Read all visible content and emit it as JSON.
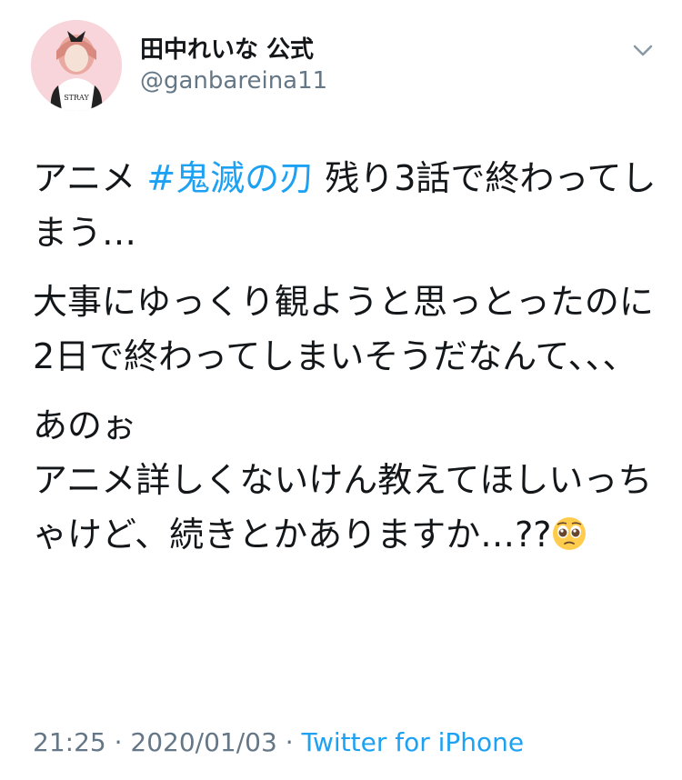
{
  "user": {
    "display_name": "田中れいな 公式",
    "handle": "@ganbareina11",
    "avatar_text": "STRAY"
  },
  "tweet": {
    "p1_pre": "アニメ ",
    "hashtag": "#鬼滅の刃",
    "p1_post": " 残り3話で終わってしまう…",
    "p2": "大事にゆっくり観ようと思っとったのに2日で終わってしまいそうだなんて、、、",
    "p3_line1": "あのぉ",
    "p3_line2": "アニメ詳しくないけん教えてほしいっちゃけど、続きとかありますか…??",
    "emoji": "pleading-face"
  },
  "meta": {
    "time": "21:25",
    "sep1": " · ",
    "date": "2020/01/03",
    "sep2": " · ",
    "source": "Twitter for iPhone"
  },
  "colors": {
    "link": "#1da1f2",
    "secondary": "#657786",
    "text": "#14171a"
  }
}
